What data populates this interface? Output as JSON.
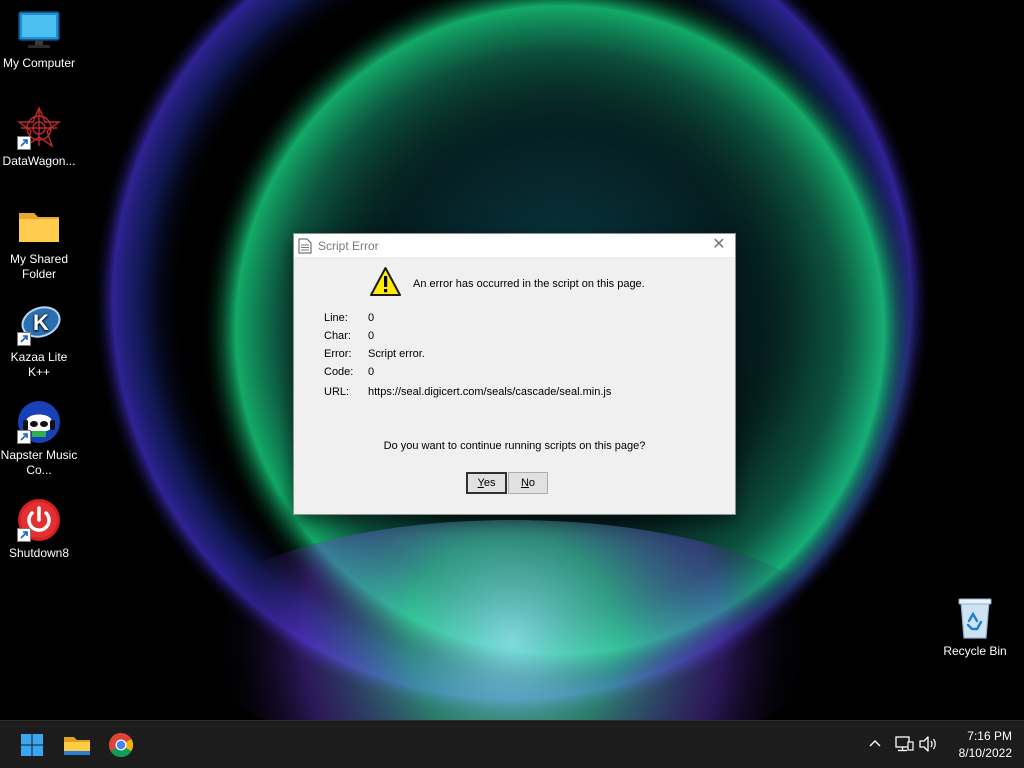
{
  "desktop": {
    "icons": [
      {
        "label": "My Computer",
        "icon": "monitor-icon",
        "shortcut": false
      },
      {
        "label": "DataWagon...",
        "icon": "datawagon-icon",
        "shortcut": true
      },
      {
        "label": "My Shared Folder",
        "icon": "folder-icon",
        "shortcut": false
      },
      {
        "label": "Kazaa Lite K++",
        "icon": "kazaa-icon",
        "shortcut": true
      },
      {
        "label": "Napster Music Co...",
        "icon": "napster-icon",
        "shortcut": true
      },
      {
        "label": "Shutdown8",
        "icon": "power-icon",
        "shortcut": true
      },
      {
        "label": "Recycle Bin",
        "icon": "recycle-bin-icon",
        "shortcut": false
      }
    ]
  },
  "dialog": {
    "title": "Script Error",
    "close_glyph": "✕",
    "message": "An error has occurred in the script on this page.",
    "details": [
      {
        "label": "Line:",
        "value": "0"
      },
      {
        "label": "Char:",
        "value": "0"
      },
      {
        "label": "Error:",
        "value": "Script error."
      },
      {
        "label": "Code:",
        "value": "0"
      },
      {
        "label": "URL:",
        "value": "https://seal.digicert.com/seals/cascade/seal.min.js"
      }
    ],
    "question": "Do you want to continue running scripts on this page?",
    "buttons": {
      "yes": {
        "mnemonic": "Y",
        "rest": "es"
      },
      "no": {
        "mnemonic": "N",
        "rest": "o"
      }
    }
  },
  "taskbar": {
    "pinned": [
      {
        "icon": "windows-start-icon"
      },
      {
        "icon": "file-explorer-icon"
      },
      {
        "icon": "chrome-icon"
      }
    ],
    "tray": {
      "icons": [
        "chevron-up-icon",
        "network-icon",
        "volume-icon"
      ],
      "time": "7:16 PM",
      "date": "8/10/2022"
    }
  },
  "colors": {
    "taskbar_bg": "#1c1c1c",
    "dialog_bg": "#f0f0f0",
    "warning_yellow": "#ffec00",
    "power_red": "#d42020"
  }
}
